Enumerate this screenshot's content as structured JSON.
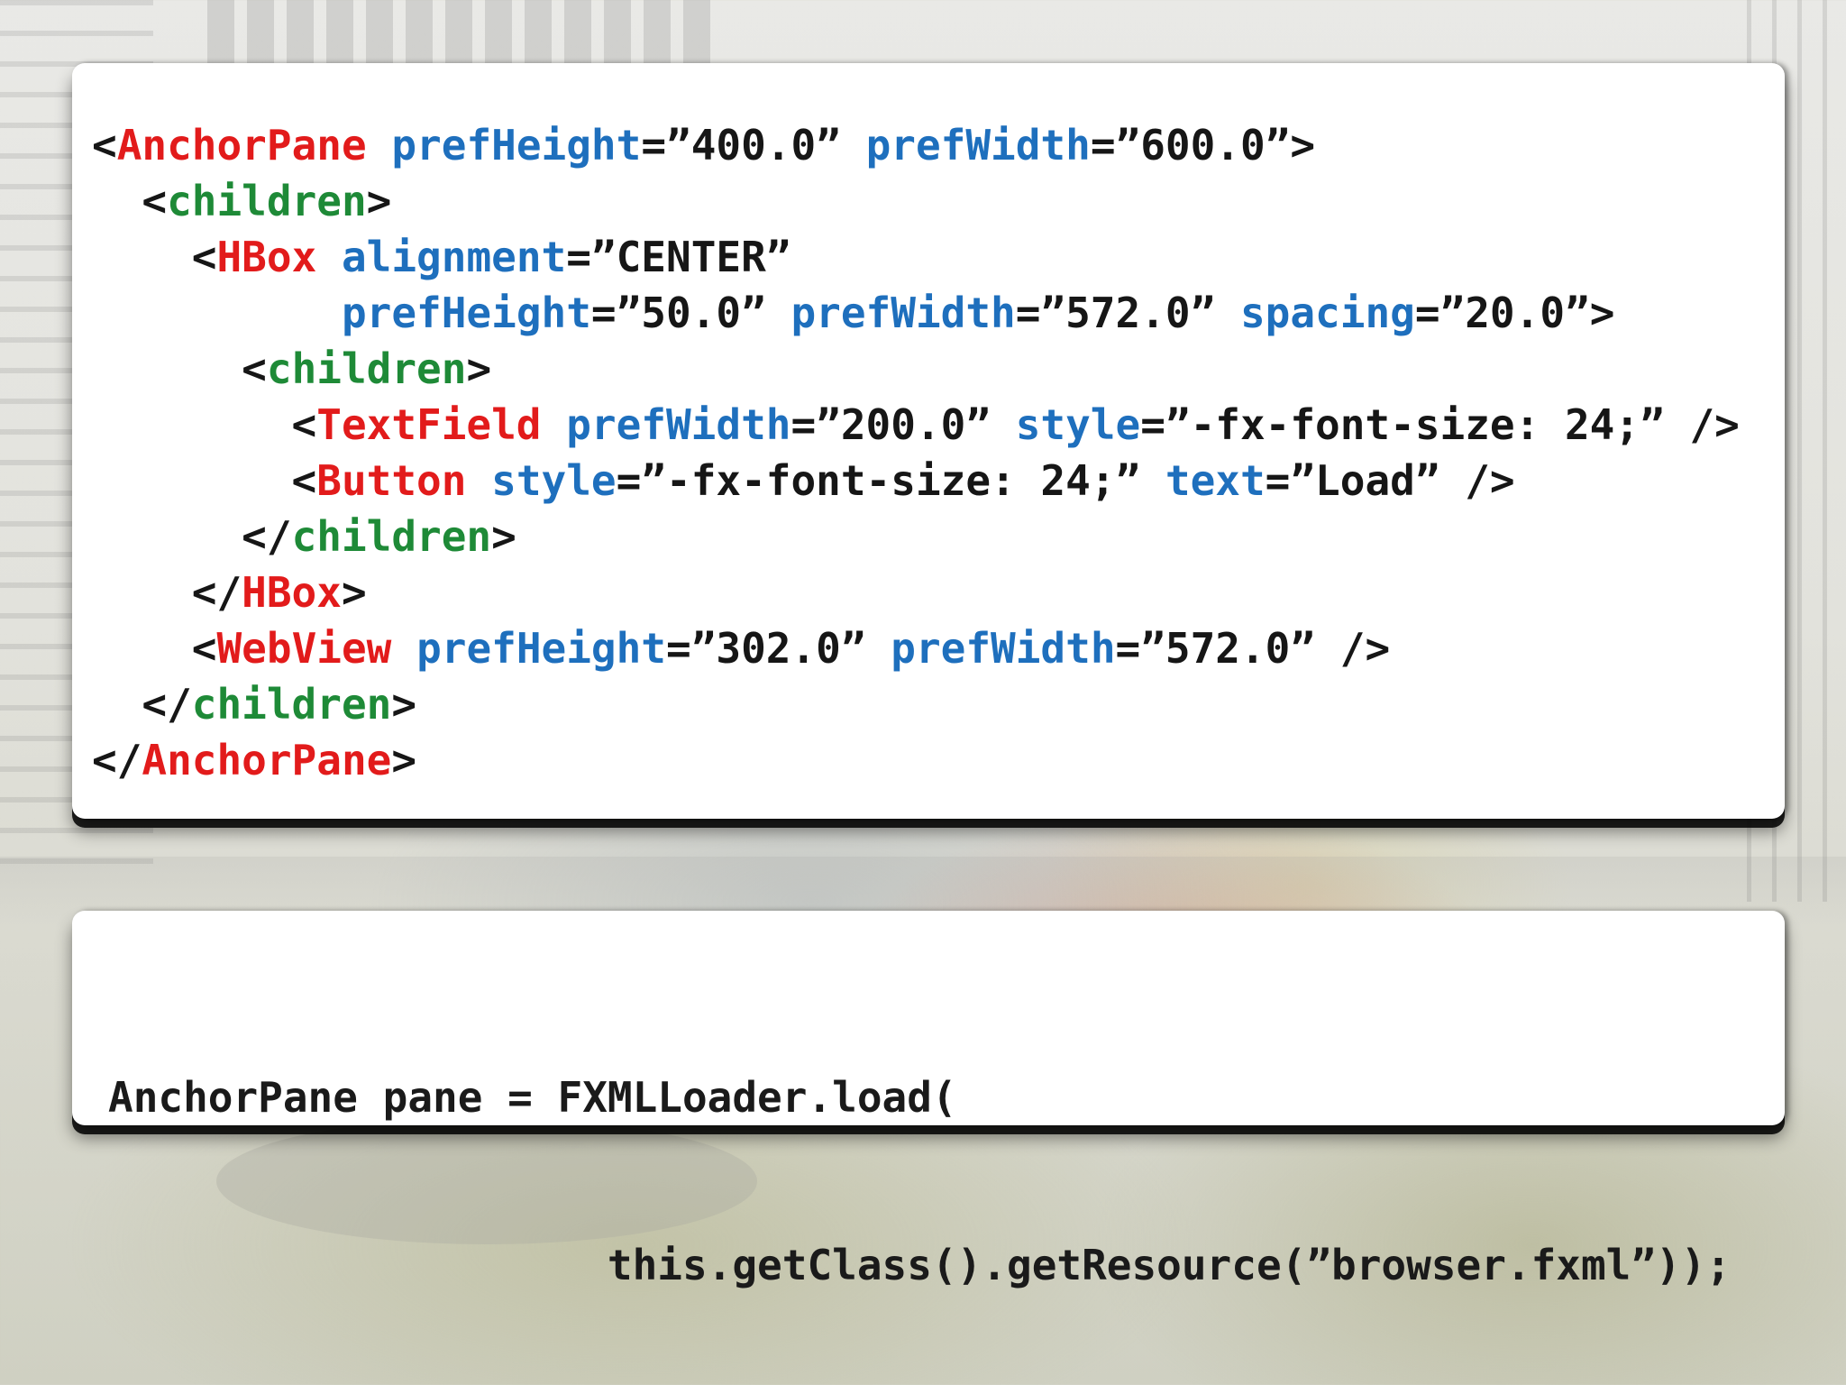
{
  "fxml": {
    "lines": [
      [
        {
          "t": "<",
          "c": "punct"
        },
        {
          "t": "AnchorPane",
          "c": "tag"
        },
        {
          "t": " ",
          "c": "punct"
        },
        {
          "t": "prefHeight",
          "c": "attr"
        },
        {
          "t": "=”400.0” ",
          "c": "val"
        },
        {
          "t": "prefWidth",
          "c": "attr"
        },
        {
          "t": "=”600.0”>",
          "c": "val"
        }
      ],
      [
        {
          "t": "  <",
          "c": "punct"
        },
        {
          "t": "children",
          "c": "child"
        },
        {
          "t": ">",
          "c": "punct"
        }
      ],
      [
        {
          "t": "    <",
          "c": "punct"
        },
        {
          "t": "HBox",
          "c": "tag"
        },
        {
          "t": " ",
          "c": "punct"
        },
        {
          "t": "alignment",
          "c": "attr"
        },
        {
          "t": "=”CENTER”",
          "c": "val"
        }
      ],
      [
        {
          "t": "          ",
          "c": "punct"
        },
        {
          "t": "prefHeight",
          "c": "attr"
        },
        {
          "t": "=”50.0” ",
          "c": "val"
        },
        {
          "t": "prefWidth",
          "c": "attr"
        },
        {
          "t": "=”572.0” ",
          "c": "val"
        },
        {
          "t": "spacing",
          "c": "attr"
        },
        {
          "t": "=”20.0”>",
          "c": "val"
        }
      ],
      [
        {
          "t": "      <",
          "c": "punct"
        },
        {
          "t": "children",
          "c": "child"
        },
        {
          "t": ">",
          "c": "punct"
        }
      ],
      [
        {
          "t": "        <",
          "c": "punct"
        },
        {
          "t": "TextField",
          "c": "tag"
        },
        {
          "t": " ",
          "c": "punct"
        },
        {
          "t": "prefWidth",
          "c": "attr"
        },
        {
          "t": "=”200.0” ",
          "c": "val"
        },
        {
          "t": "style",
          "c": "attr"
        },
        {
          "t": "=”-fx-font-size: 24;” />",
          "c": "val"
        }
      ],
      [
        {
          "t": "        <",
          "c": "punct"
        },
        {
          "t": "Button",
          "c": "tag"
        },
        {
          "t": " ",
          "c": "punct"
        },
        {
          "t": "style",
          "c": "attr"
        },
        {
          "t": "=”-fx-font-size: 24;” ",
          "c": "val"
        },
        {
          "t": "text",
          "c": "attr"
        },
        {
          "t": "=”Load” />",
          "c": "val"
        }
      ],
      [
        {
          "t": "      </",
          "c": "punct"
        },
        {
          "t": "children",
          "c": "child"
        },
        {
          "t": ">",
          "c": "punct"
        }
      ],
      [
        {
          "t": "    </",
          "c": "punct"
        },
        {
          "t": "HBox",
          "c": "tag"
        },
        {
          "t": ">",
          "c": "punct"
        }
      ],
      [
        {
          "t": "    <",
          "c": "punct"
        },
        {
          "t": "WebView",
          "c": "tag"
        },
        {
          "t": " ",
          "c": "punct"
        },
        {
          "t": "prefHeight",
          "c": "attr"
        },
        {
          "t": "=”302.0” ",
          "c": "val"
        },
        {
          "t": "prefWidth",
          "c": "attr"
        },
        {
          "t": "=”572.0” />",
          "c": "val"
        }
      ],
      [
        {
          "t": "  </",
          "c": "punct"
        },
        {
          "t": "children",
          "c": "child"
        },
        {
          "t": ">",
          "c": "punct"
        }
      ],
      [
        {
          "t": "</",
          "c": "punct"
        },
        {
          "t": "AnchorPane",
          "c": "tag"
        },
        {
          "t": ">",
          "c": "punct"
        }
      ]
    ]
  },
  "java": {
    "line1": "AnchorPane pane = FXMLLoader.load(",
    "line2": "                    this.getClass().getResource(”browser.fxml”));"
  },
  "colors": {
    "tag": "#e21b1b",
    "child": "#1e8a37",
    "attr": "#1e6fbd",
    "text": "#161616"
  }
}
